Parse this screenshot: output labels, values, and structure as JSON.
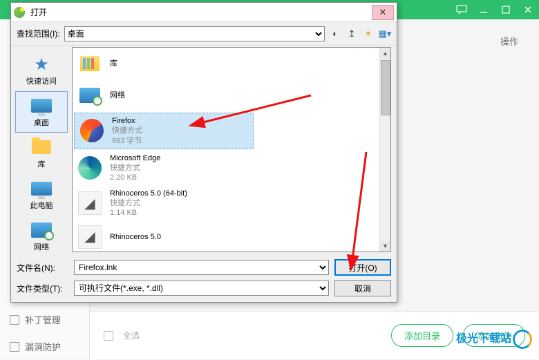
{
  "background": {
    "sidebar": {
      "patch": "补丁管理",
      "vuln": "漏洞防护"
    },
    "ops": "操作",
    "bottom": {
      "select_all": "全选",
      "add_dir": "添加目录",
      "add_file": "添加文件"
    },
    "watermark": "极光下载站"
  },
  "dialog": {
    "title": "打开",
    "look_in_label": "查找范围(I):",
    "look_in_value": "桌面",
    "places": [
      {
        "label": "快速访问",
        "icon": "star"
      },
      {
        "label": "桌面",
        "icon": "monitor",
        "selected": true
      },
      {
        "label": "库",
        "icon": "folder"
      },
      {
        "label": "此电脑",
        "icon": "monitor"
      },
      {
        "label": "网络",
        "icon": "net"
      }
    ],
    "files": [
      {
        "name": "库",
        "sub1": "",
        "sub2": "",
        "icon": "lib"
      },
      {
        "name": "网络",
        "sub1": "",
        "sub2": "",
        "icon": "net"
      },
      {
        "name": "Firefox",
        "sub1": "快捷方式",
        "sub2": "993 字节",
        "icon": "firefox",
        "selected": true
      },
      {
        "name": "Microsoft Edge",
        "sub1": "快捷方式",
        "sub2": "2.20 KB",
        "icon": "edge"
      },
      {
        "name": "Rhinoceros 5.0 (64-bit)",
        "sub1": "快捷方式",
        "sub2": "1.14 KB",
        "icon": "rhino"
      },
      {
        "name": "Rhinoceros 5.0",
        "sub1": "",
        "sub2": "",
        "icon": "rhino"
      }
    ],
    "footer": {
      "filename_label": "文件名(N):",
      "filename_value": "Firefox.lnk",
      "filetype_label": "文件类型(T):",
      "filetype_value": "可执行文件(*.exe, *.dll)",
      "open": "打开(O)",
      "cancel": "取消"
    }
  }
}
